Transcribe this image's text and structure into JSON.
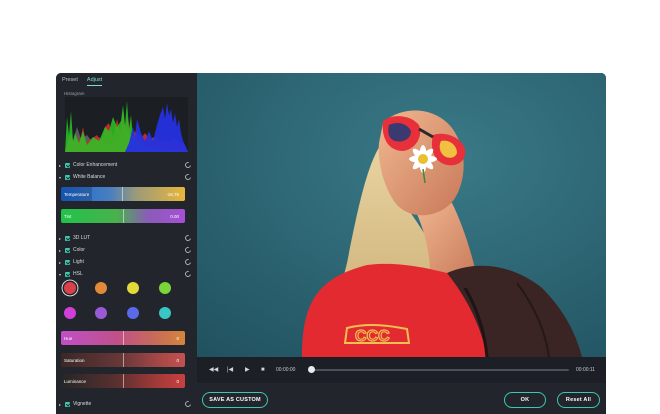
{
  "tabs": [
    {
      "label": "Preset",
      "active": false
    },
    {
      "label": "Adjust",
      "active": true
    }
  ],
  "histogram": {
    "label": "Histogram",
    "colors": [
      "#e03030",
      "#22c020",
      "#2233e0",
      "#8a8a8a"
    ]
  },
  "sections": {
    "color_enhancement": "Color Enhancement",
    "white_balance": "White Balance",
    "lut3d": "3D LUT",
    "color": "Color",
    "light": "Light",
    "hsl": "HSL",
    "vignette": "Vignette"
  },
  "sliders": {
    "temperature": {
      "label": "Temperature",
      "value": "-16.75"
    },
    "tint": {
      "label": "Tint",
      "value": "0.00"
    },
    "hue": {
      "label": "Hue",
      "value": "0"
    },
    "saturation": {
      "label": "Saturation",
      "value": "0"
    },
    "luminance": {
      "label": "Luminance",
      "value": "0"
    }
  },
  "hsl_swatches": [
    "#d9404a",
    "#e08a3a",
    "#e4d83a",
    "#7ad43a",
    "#d040d8",
    "#9a5ad8",
    "#5a6ae8",
    "#3ac4c4"
  ],
  "transport": {
    "current_time": "00:00:00",
    "total_time": "00:00:11",
    "progress": 0
  },
  "buttons": {
    "save_custom": "SAVE AS CUSTOM",
    "ok": "OK",
    "reset_all": "Reset All"
  },
  "colors": {
    "accent": "#3ec7b0",
    "panel": "#22262c",
    "sky": "#2f6877"
  }
}
